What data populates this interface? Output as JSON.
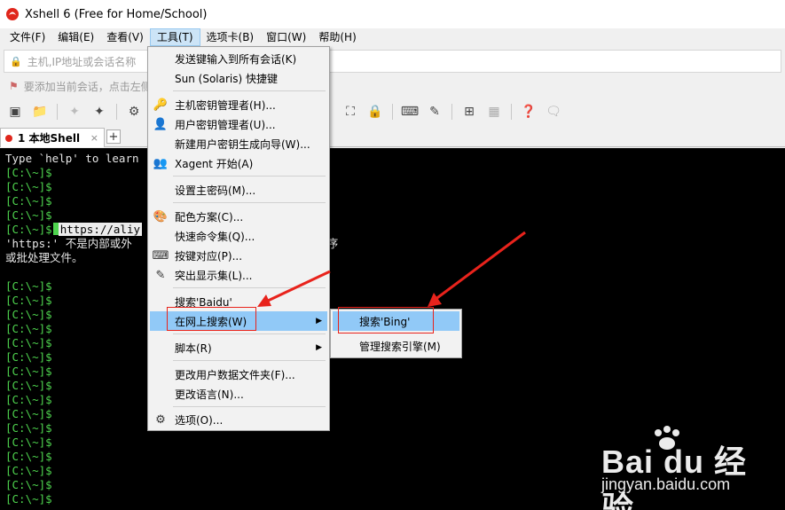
{
  "window": {
    "title": "Xshell 6 (Free for Home/School)"
  },
  "menubar": {
    "items": [
      "文件(F)",
      "编辑(E)",
      "查看(V)",
      "工具(T)",
      "选项卡(B)",
      "窗口(W)",
      "帮助(H)"
    ],
    "active": "工具(T)"
  },
  "address": {
    "placeholder": "主机,IP地址或会话名称"
  },
  "hint": {
    "text": "要添加当前会话，点击左侧"
  },
  "tab": {
    "label": "1 本地Shell",
    "close": "×",
    "add": "+"
  },
  "terminal": {
    "intro": "Type `help' to learn",
    "prompt": "[C:\\~]$",
    "command": "https://aliy",
    "error_line1": "'https:' 不是内部或外",
    "error_line1_tail": "序",
    "error_line2": "或批处理文件。"
  },
  "tools_menu": {
    "items": [
      {
        "label": "发送键输入到所有会话(K)",
        "icon": ""
      },
      {
        "label": "Sun (Solaris) 快捷键",
        "icon": ""
      },
      {
        "label": "主机密钥管理者(H)...",
        "icon": "key-manager-icon"
      },
      {
        "label": "用户密钥管理者(U)...",
        "icon": "user-key-icon"
      },
      {
        "label": "新建用户密钥生成向导(W)...",
        "icon": ""
      },
      {
        "label": "Xagent 开始(A)",
        "icon": "xagent-icon"
      },
      {
        "label": "设置主密码(M)...",
        "icon": ""
      },
      {
        "label": "配色方案(C)...",
        "icon": "color-scheme-icon"
      },
      {
        "label": "快速命令集(Q)...",
        "icon": ""
      },
      {
        "label": "按键对应(P)...",
        "icon": "keyboard-icon"
      },
      {
        "label": "突出显示集(L)...",
        "icon": "highlight-icon"
      },
      {
        "label": "搜索'Baidu'",
        "icon": ""
      },
      {
        "label": "在网上搜索(W)",
        "icon": ""
      },
      {
        "label": "脚本(R)",
        "icon": ""
      },
      {
        "label": "更改用户数据文件夹(F)...",
        "icon": ""
      },
      {
        "label": "更改语言(N)...",
        "icon": ""
      },
      {
        "label": "选项(O)...",
        "icon": "gear-icon"
      }
    ]
  },
  "search_submenu": {
    "items": [
      "搜索'Bing'",
      "管理搜索引擎(M)"
    ]
  },
  "watermark": {
    "brand": "Bai du 经验",
    "url": "jingyan.baidu.com"
  },
  "colors": {
    "accent": "#91c9f7",
    "prompt": "#4ed34e",
    "annotation": "#e8231c"
  }
}
